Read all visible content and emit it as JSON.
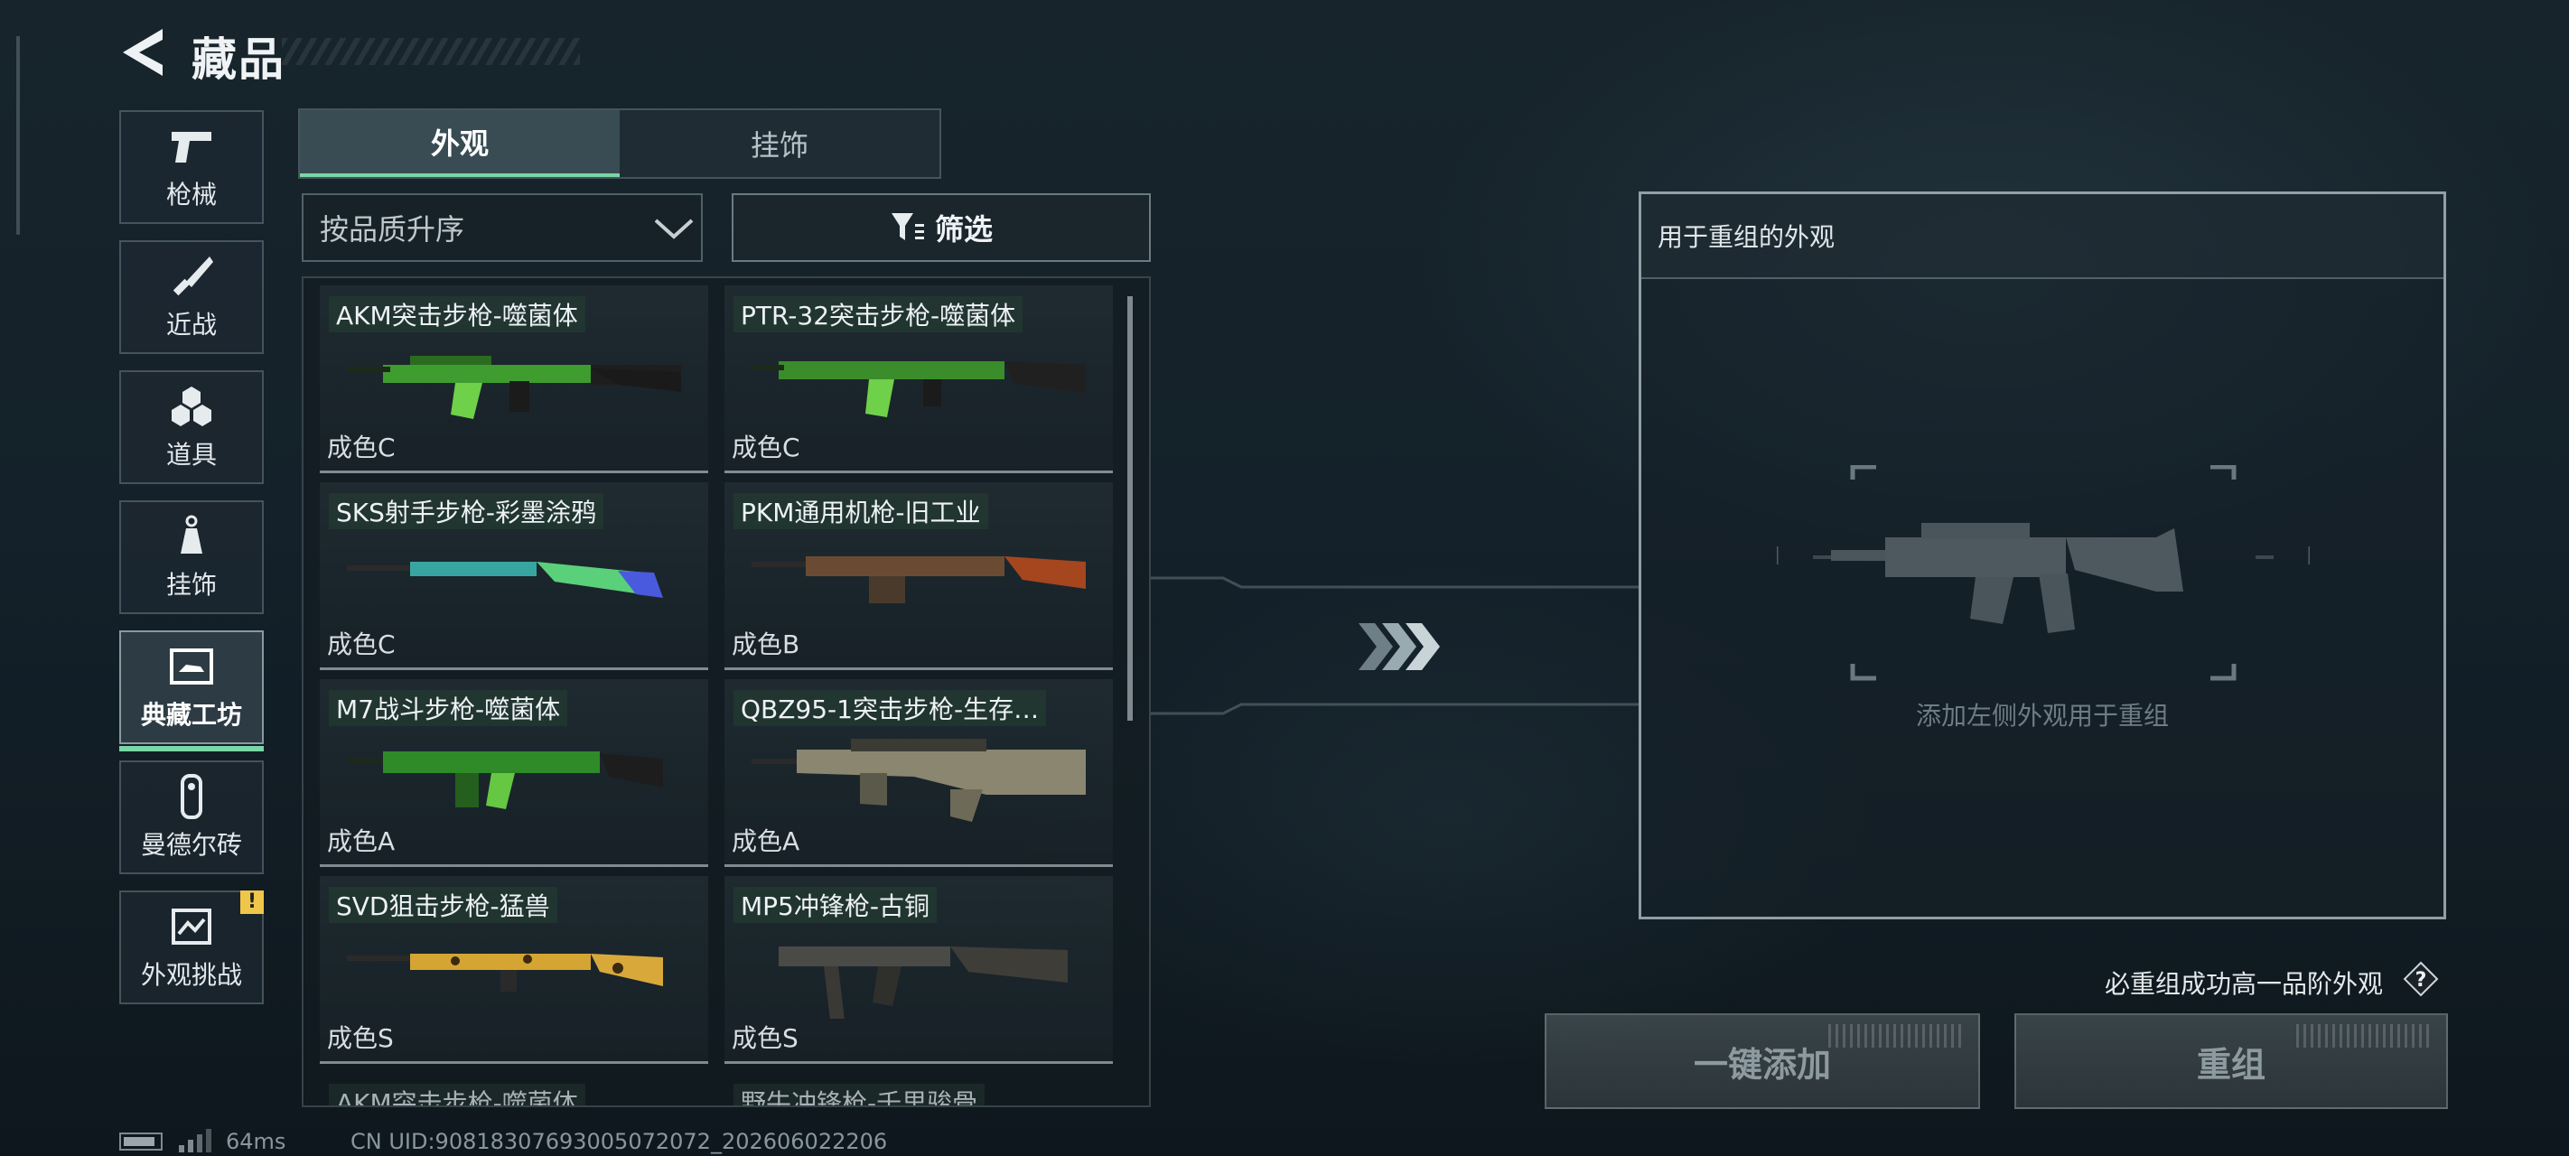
{
  "header": {
    "title": "藏品"
  },
  "nav": [
    {
      "label": "枪械",
      "icon": "pistol-icon"
    },
    {
      "label": "近战",
      "icon": "knife-icon"
    },
    {
      "label": "道具",
      "icon": "grenades-icon"
    },
    {
      "label": "挂饰",
      "icon": "charm-icon"
    },
    {
      "label": "典藏工坊",
      "icon": "workshop-icon",
      "active": true
    },
    {
      "label": "曼德尔砖",
      "icon": "mandel-brick-icon"
    },
    {
      "label": "外观挑战",
      "icon": "challenge-icon",
      "badge": "!"
    }
  ],
  "tabs": [
    {
      "label": "外观",
      "active": true
    },
    {
      "label": "挂饰",
      "active": false
    }
  ],
  "sort": {
    "label": "按品质升序"
  },
  "filter": {
    "label": "筛选"
  },
  "items": [
    {
      "name": "AKM突击步枪-噬菌体",
      "grade": "成色C",
      "skin": "green"
    },
    {
      "name": "PTR-32突击步枪-噬菌体",
      "grade": "成色C",
      "skin": "green"
    },
    {
      "name": "SKS射手步枪-彩墨涂鸦",
      "grade": "成色C",
      "skin": "teal"
    },
    {
      "name": "PKM通用机枪-旧工业",
      "grade": "成色B",
      "skin": "rust"
    },
    {
      "name": "M7战斗步枪-噬菌体",
      "grade": "成色A",
      "skin": "green"
    },
    {
      "name": "QBZ95-1突击步枪-生存…",
      "grade": "成色A",
      "skin": "camo"
    },
    {
      "name": "SVD狙击步枪-猛兽",
      "grade": "成色S",
      "skin": "leopard"
    },
    {
      "name": "MP5冲锋枪-古铜",
      "grade": "成色S",
      "skin": "bronze"
    }
  ],
  "peek_items": [
    "AKM突击步枪-噬菌体",
    "野牛冲锋枪-千里骏骨"
  ],
  "panel": {
    "title": "用于重组的外观",
    "placeholder": "添加左侧外观用于重组"
  },
  "guarantee_text": "必重组成功高一品阶外观",
  "buttons": {
    "add_all": "一键添加",
    "recombine": "重组"
  },
  "footer": {
    "ping": "64ms",
    "uid": "CN UID:90818307693005072072_202606022206"
  },
  "colors": {
    "accent": "#79d6a6",
    "warning": "#f0c64a"
  }
}
